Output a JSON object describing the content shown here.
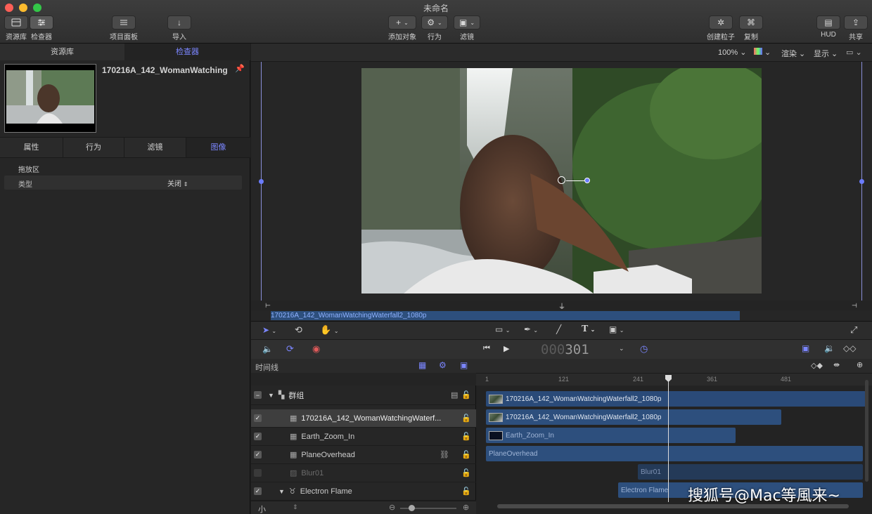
{
  "window": {
    "title": "未命名"
  },
  "toolbar": {
    "library_label": "资源库",
    "inspector_label": "检查器",
    "project_label": "项目面板",
    "import_label": "导入",
    "add_object_label": "添加对象",
    "behavior_label": "行为",
    "filter_label": "滤镜",
    "create_particle_label": "创建粒子",
    "copy_label": "复制",
    "hud_label": "HUD",
    "share_label": "共享"
  },
  "left_panel": {
    "tabs": [
      "资源库",
      "检查器"
    ],
    "active_tab": "检查器",
    "clip_name": "170216A_142_WomanWatching",
    "inspector_tabs": [
      "属性",
      "行为",
      "滤镜",
      "图像"
    ],
    "active_inspector_tab": "图像",
    "section_title": "拖放区",
    "row_label": "类型",
    "row_value": "关闭"
  },
  "viewer": {
    "zoom": "100%",
    "render_label": "渲染",
    "display_label": "显示",
    "clip_bar_label": "170216A_142_WomanWatchingWaterfall2_1080p"
  },
  "transport": {
    "timecode_dim": "000",
    "timecode": "301"
  },
  "timeline": {
    "header_label": "时间线",
    "ruler_ticks": [
      "1",
      "121",
      "241",
      "361",
      "481"
    ],
    "group_name": "群组",
    "layers": [
      {
        "name": "170216A_142_WomanWatchingWaterf...",
        "checked": true
      },
      {
        "name": "Earth_Zoom_In",
        "checked": true
      },
      {
        "name": "PlaneOverhead",
        "checked": true
      },
      {
        "name": "Blur01",
        "checked": false
      },
      {
        "name": "Electron Flame",
        "checked": true
      }
    ],
    "bars": [
      {
        "label": "170216A_142_WomanWatchingWaterfall2_1080p"
      },
      {
        "label": "170216A_142_WomanWatchingWaterfall2_1080p"
      },
      {
        "label": "Earth_Zoom_In"
      },
      {
        "label": "PlaneOverhead"
      },
      {
        "label": "Blur01"
      },
      {
        "label": "Electron Flame"
      }
    ],
    "size_label": "小"
  },
  "watermark": "搜狐号@Mac等風来~",
  "colors": {
    "accent": "#6b7cff",
    "bar": "#2d4f7d"
  }
}
